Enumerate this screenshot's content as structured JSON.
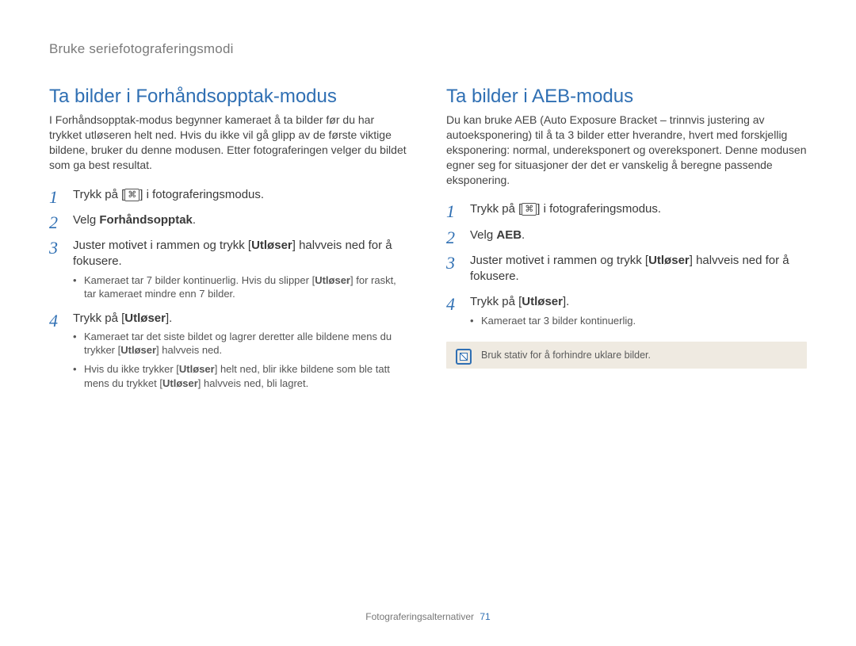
{
  "breadcrumb": "Bruke seriefotograferingsmodi",
  "left": {
    "title": "Ta bilder i Forhåndsopptak-modus",
    "intro": "I Forhåndsopptak-modus begynner kameraet å ta bilder før du har trykket utløseren helt ned. Hvis du ikke vil gå glipp av de første viktige bildene, bruker du denne modusen. Etter fotograferingen velger du bildet som ga best resultat.",
    "step1_pre": "Trykk på [",
    "step1_icon": "⌘",
    "step1_post": "] i fotograferingsmodus.",
    "step2_pre": "Velg ",
    "step2_bold": "Forhåndsopptak",
    "step2_post": ".",
    "step3_a": "Juster motivet i rammen og trykk [",
    "step3_b": "Utløser",
    "step3_c": "] halvveis ned for å fokusere.",
    "step3_sub1_a": "Kameraet tar 7 bilder kontinuerlig. Hvis du slipper [",
    "step3_sub1_b": "Utløser",
    "step3_sub1_c": "] for raskt, tar kameraet mindre enn 7 bilder.",
    "step4_a": "Trykk på [",
    "step4_b": "Utløser",
    "step4_c": "].",
    "step4_sub1_a": "Kameraet tar det siste bildet og lagrer deretter alle bildene mens du trykker [",
    "step4_sub1_b": "Utløser",
    "step4_sub1_c": "] halvveis ned.",
    "step4_sub2_a": "Hvis du ikke trykker [",
    "step4_sub2_b": "Utløser",
    "step4_sub2_c": "] helt ned, blir ikke bildene som ble tatt mens du trykket [",
    "step4_sub2_d": "Utløser",
    "step4_sub2_e": "] halvveis ned, bli lagret."
  },
  "right": {
    "title": "Ta bilder i AEB-modus",
    "intro": "Du kan bruke AEB (Auto Exposure Bracket – trinnvis justering av autoeksponering) til å ta 3 bilder etter hverandre, hvert med forskjellig eksponering: normal, undereksponert og overeksponert. Denne modusen egner seg for situasjoner der det er vanskelig å beregne passende eksponering.",
    "step1_pre": "Trykk på [",
    "step1_icon": "⌘",
    "step1_post": "] i fotograferingsmodus.",
    "step2_pre": "Velg ",
    "step2_bold": "AEB",
    "step2_post": ".",
    "step3_a": "Juster motivet i rammen og trykk [",
    "step3_b": "Utløser",
    "step3_c": "] halvveis ned for å fokusere.",
    "step4_a": "Trykk på [",
    "step4_b": "Utløser",
    "step4_c": "].",
    "step4_sub1": "Kameraet tar 3 bilder kontinuerlig.",
    "note": "Bruk stativ for å forhindre uklare bilder."
  },
  "footer": {
    "section": "Fotograferingsalternativer",
    "page": "71"
  }
}
